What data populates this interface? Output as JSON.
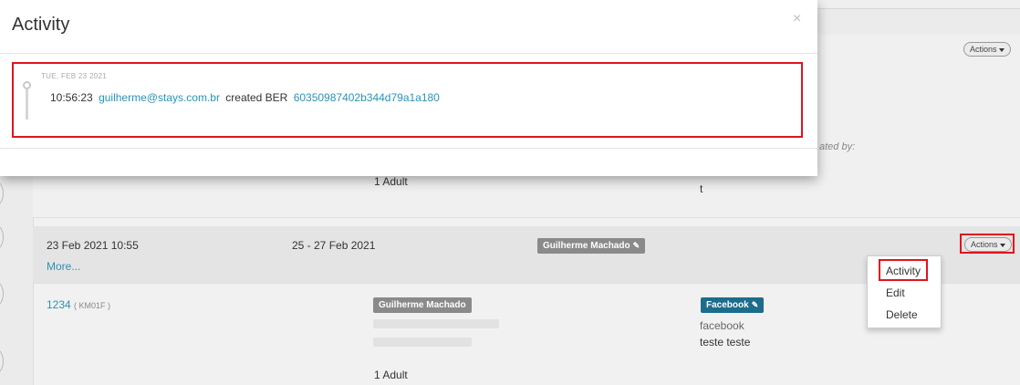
{
  "modal": {
    "title": "Activity",
    "close_glyph": "×",
    "date_header": "TUE, FEB 23 2021",
    "entry": {
      "time": "10:56:23",
      "user": "guilherme@stays.com.br",
      "action": "created BER",
      "reference": "60350987402b344d79a1a180"
    }
  },
  "background": {
    "row1": {
      "actions_label": "Actions",
      "partial_text": "ated by:",
      "guests": "1 Adult",
      "note": "t"
    },
    "row2": {
      "created": "23 Feb 2021 10:55",
      "more_link": "More...",
      "period": "25 - 27 Feb 2021",
      "agent_tag": "Guilherme Machado",
      "actions_label": "Actions"
    },
    "row3": {
      "listing_id": "1234",
      "listing_code": "( KM01F )",
      "agent_tag": "Guilherme Machado",
      "channel_tag": "Facebook",
      "channel_name": "facebook",
      "guest_name": "teste teste",
      "guests": "1 Adult"
    }
  },
  "dropdown": {
    "items": [
      {
        "label": "Activity"
      },
      {
        "label": "Edit"
      },
      {
        "label": "Delete"
      }
    ]
  },
  "icons": {
    "caret": "caret-down-icon",
    "pencil": "pencil-icon",
    "close": "close-icon"
  },
  "colors": {
    "link": "#2a93b5",
    "highlight": "#e0141e",
    "channel_tag": "#1c6c8c",
    "agent_tag": "#8a8a8a"
  }
}
